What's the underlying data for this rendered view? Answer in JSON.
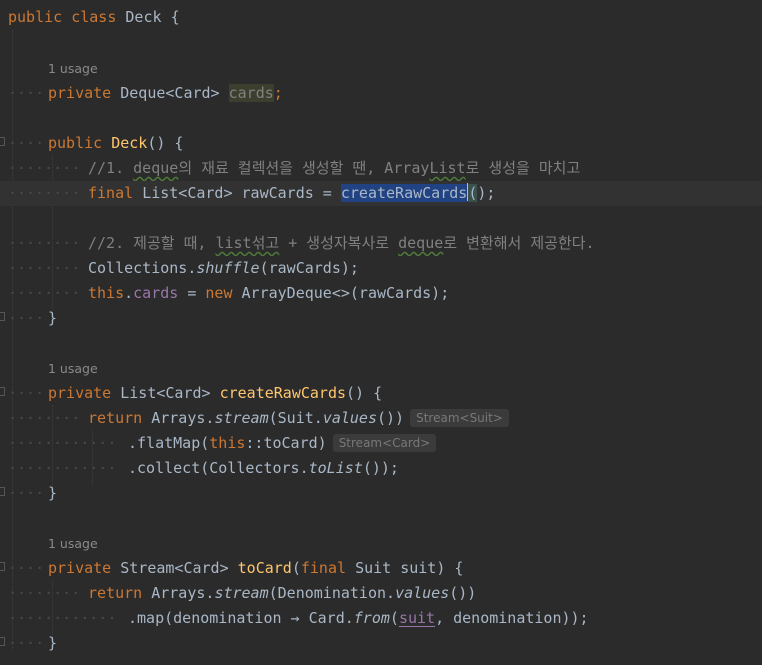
{
  "editor": {
    "usage_hints": {
      "cards": "1 usage",
      "createRawCards": "1 usage",
      "toCard": "1 usage"
    },
    "tokens": {
      "public": "public",
      "class": "class",
      "Deck": "Deck",
      "open_brace": "{",
      "close_brace": "}",
      "private": "private",
      "Deque_Card": "Deque<Card>",
      "cards": "cards",
      "semicolon": ";",
      "Deck_ctor": "Deck",
      "ctor_parens": "() {",
      "comment1": "//1. ",
      "comment1_deque": "deque",
      "comment1_rest": "의 재료 컬렉션을 생성할 땐, Array",
      "comment1_list": "List",
      "comment1_end": "로 생성을 마치고",
      "final": "final",
      "List_Card": "List<Card>",
      "rawCards_assign": "rawCards =",
      "createRawCards": "createRawCards",
      "call_end": "();",
      "call_open": "(",
      "comment2": "//2. 제공할 때, ",
      "comment2_list": "list섞고",
      "comment2_mid": " + 생성자복사로 ",
      "comment2_deque": "deque",
      "comment2_end": "로 변환해서 제공한다.",
      "Collections_dot": "Collections.",
      "shuffle": "shuffle",
      "shuffle_args": "(rawCards);",
      "this": "this",
      "dot_cards_prefix": ".",
      "assign_new": " = ",
      "new": "new",
      "ArrayDeque_rest": "ArrayDeque<>(rawCards);",
      "createRawCards_decl": "createRawCards",
      "method_open": "() {",
      "return": "return",
      "Arrays_dot": "Arrays.",
      "stream": "stream",
      "suit_values_open": "(Suit.",
      "values": "values",
      "values_close": "())",
      "inlay_stream_suit": "Stream<Suit>",
      "flatMap_open": ".flatMap(",
      "method_ref": "::toCard)",
      "inlay_stream_card": "Stream<Card>",
      "collect_open": ".collect(Collectors.",
      "toList": "toList",
      "toList_close": "());",
      "Stream_Card": "Stream<Card>",
      "toCard": "toCard",
      "paren_open": "(",
      "suit_param": "Suit suit) {",
      "denom_open": "(Denomination.",
      "map_open": ".map(denomination → Card.",
      "from": "from",
      "suit_ref": "suit",
      "denom_close": ", denomination));"
    }
  }
}
